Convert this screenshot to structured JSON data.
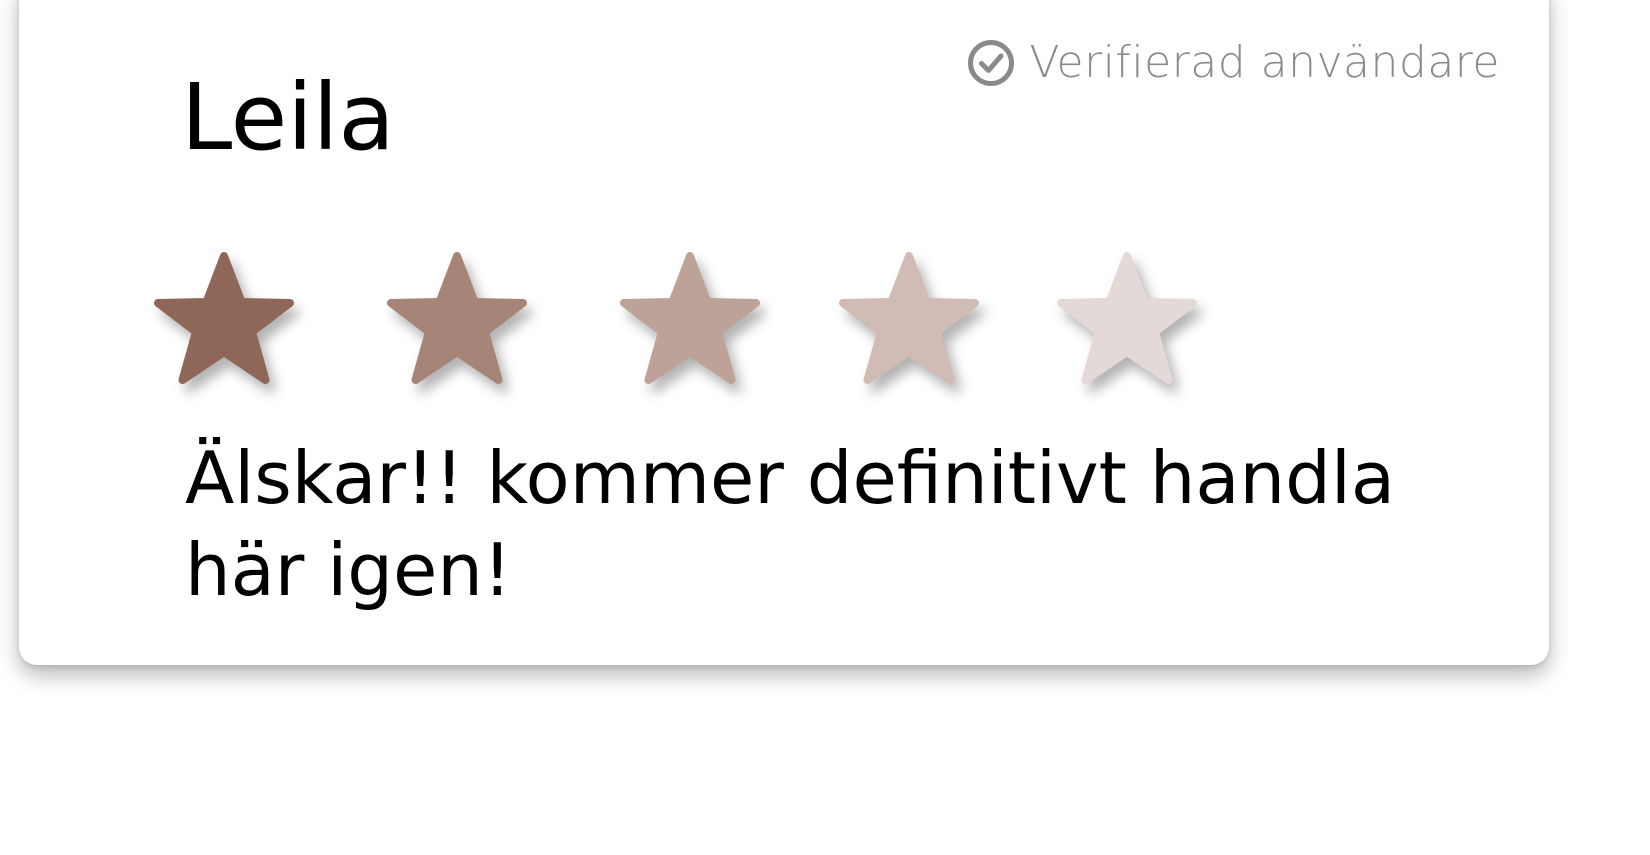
{
  "review": {
    "reviewer_name": "Leila",
    "verified_label": "Verifierad användare",
    "verified_icon": "check-circle-icon",
    "rating": {
      "value": 5,
      "max": 5,
      "star_colors": [
        "#8e6758",
        "#a68578",
        "#bda397",
        "#d0bcb5",
        "#e3d9d6"
      ]
    },
    "text": "Älskar!! kommer definitivt handla här igen!"
  }
}
